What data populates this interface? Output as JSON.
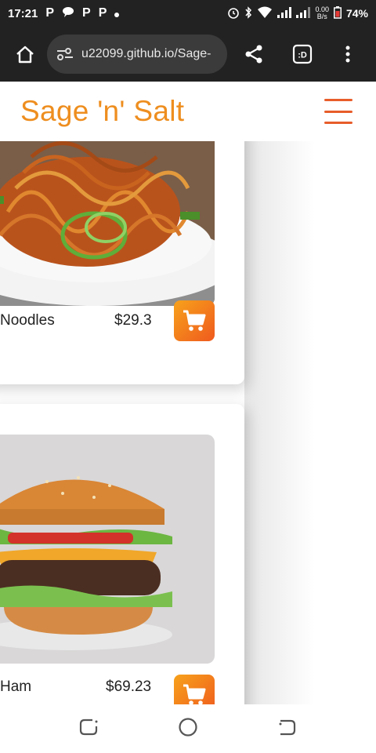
{
  "status": {
    "time": "17:21",
    "net_speed_value": "0.00",
    "net_speed_unit": "B/s",
    "battery": "74%",
    "icons": [
      "parking-icon",
      "chat-icon",
      "parking-icon",
      "parking-icon",
      "dot-icon",
      "alarm-icon",
      "bluetooth-icon",
      "wifi-icon",
      "signal-icon",
      "signal-icon",
      "battery-icon"
    ]
  },
  "browser": {
    "url": "u22099.github.io/Sage-",
    "tab_label": ":D"
  },
  "site": {
    "brand": "Sage 'n' Salt"
  },
  "menu": {
    "items": [
      {
        "name": "Noodles",
        "price": "$29.3",
        "image": "noodles-photo"
      },
      {
        "name": "Ham",
        "price": "$69.23",
        "image": "burger-photo"
      }
    ]
  },
  "colors": {
    "brand": "#ee8e1f",
    "accent": "#e85d2a",
    "cart_gradient_start": "#f7a21b",
    "cart_gradient_end": "#ef5a1e",
    "dark_bar": "#222222"
  }
}
